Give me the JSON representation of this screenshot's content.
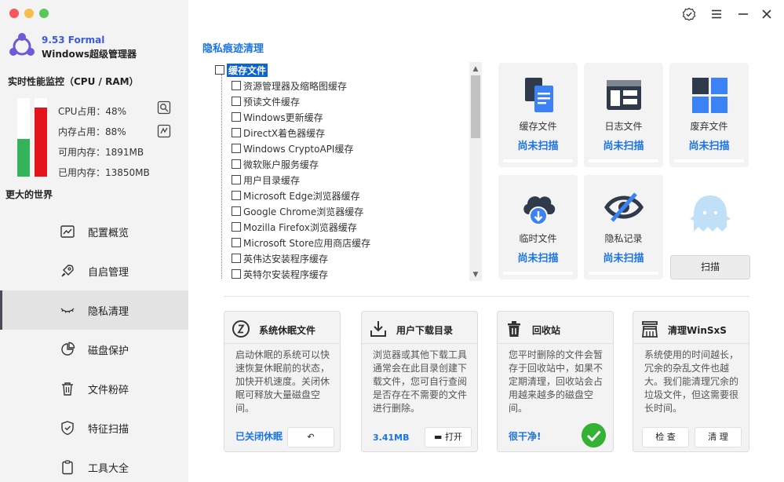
{
  "app": {
    "version": "9.53 Formal",
    "name": "Windows超级管理器",
    "slogan": "更大的世界"
  },
  "monitor": {
    "title": "实时性能监控（CPU / RAM）",
    "cpu_fill": 0.48,
    "mem_fill": 0.88,
    "cpu_label": "CPU占用：48%",
    "mem_label": "内存占用：88%",
    "avail_label": "可用内存：1891MB",
    "used_label": "已用内存：13850MB"
  },
  "nav": [
    {
      "label": "配置概览",
      "icon": "chart-icon"
    },
    {
      "label": "自启管理",
      "icon": "rocket-icon"
    },
    {
      "label": "隐私清理",
      "icon": "eye-closed-icon",
      "active": true
    },
    {
      "label": "磁盘保护",
      "icon": "pie-icon"
    },
    {
      "label": "文件粉碎",
      "icon": "trash-icon"
    },
    {
      "label": "特征扫描",
      "icon": "shield-icon"
    },
    {
      "label": "工具大全",
      "icon": "clipboard-icon"
    }
  ],
  "main": {
    "section_title": "隐私痕迹清理",
    "tree": {
      "root": "缓存文件",
      "items": [
        "资源管理器及缩略图缓存",
        "预读文件缓存",
        "Windows更新缓存",
        "DirectX着色器缓存",
        "Windows CryptoAPI缓存",
        "微软账户服务缓存",
        "用户目录缓存",
        "Microsoft Edge浏览器缓存",
        "Google Chrome浏览器缓存",
        "Mozilla Firefox浏览器缓存",
        "Microsoft Store应用商店缓存",
        "英伟达安装程序缓存",
        "英特尔安装程序缓存"
      ]
    },
    "cards": [
      {
        "label": "缓存文件",
        "status": "尚未扫描",
        "icon": "document-icon"
      },
      {
        "label": "日志文件",
        "status": "尚未扫描",
        "icon": "log-window-icon"
      },
      {
        "label": "废弃文件",
        "status": "尚未扫描",
        "icon": "grid-icon"
      },
      {
        "label": "临时文件",
        "status": "尚未扫描",
        "icon": "cloud-download-icon"
      },
      {
        "label": "隐私记录",
        "status": "尚未扫描",
        "icon": "eye-slash-icon"
      }
    ],
    "scan_label": "扫描"
  },
  "panels": [
    {
      "title": "系统休眠文件",
      "body": "启动休眠的系统可以快速恢复休眠前的状态，加快开机速度。关闭休眠可释放大量磁盘空间。",
      "footer": "已关闭休眠",
      "button": "↶"
    },
    {
      "title": "用户下载目录",
      "body": "浏览器或其他下载工具通常会在此目录创建下载文件，您可自行查阅是否存在不需要的文件进行删除。",
      "footer": "3.41MB",
      "button": "打开"
    },
    {
      "title": "回收站",
      "body": "您平时删除的文件会暂存于回收站中，如果不定期清理，回收站会占用越来越多的磁盘空间。",
      "footer": "很干净!"
    },
    {
      "title": "清理WinSxS",
      "body": "系统使用的时间越长，冗余的杂乱文件也越大。我们能清理冗余的垃圾文件，但这需要很长时间。",
      "btn_check": "检 查",
      "btn_clean": "清 理"
    }
  ]
}
